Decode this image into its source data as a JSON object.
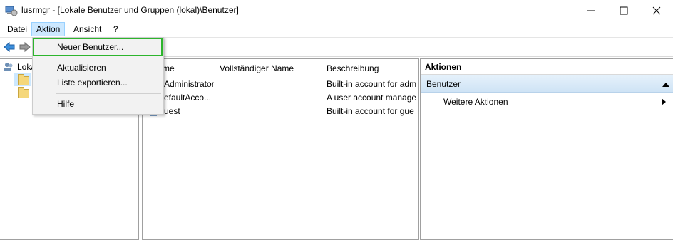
{
  "window": {
    "title": "lusrmgr - [Lokale Benutzer und Gruppen (lokal)\\Benutzer]"
  },
  "menu": {
    "items": [
      "Datei",
      "Aktion",
      "Ansicht",
      "?"
    ]
  },
  "dropdown": {
    "items": [
      "Neuer Benutzer...",
      "Aktualisieren",
      "Liste exportieren...",
      "Hilfe"
    ]
  },
  "tree": {
    "root_label": "Loka"
  },
  "list": {
    "columns": [
      "me",
      "Vollständiger Name",
      "Beschreibung"
    ],
    "rows": [
      {
        "name": "Administrator",
        "full": "",
        "desc": "Built-in account for adm"
      },
      {
        "name": "efaultAcco...",
        "full": "",
        "desc": "A user account manage"
      },
      {
        "name": "uest",
        "full": "",
        "desc": "Built-in account for gue"
      }
    ]
  },
  "actions": {
    "title": "Aktionen",
    "group": "Benutzer",
    "item": "Weitere Aktionen"
  },
  "colors": {
    "highlight": "#2db52d",
    "menu_active": "#cce8ff",
    "group_bg": "#cfe3f5"
  }
}
